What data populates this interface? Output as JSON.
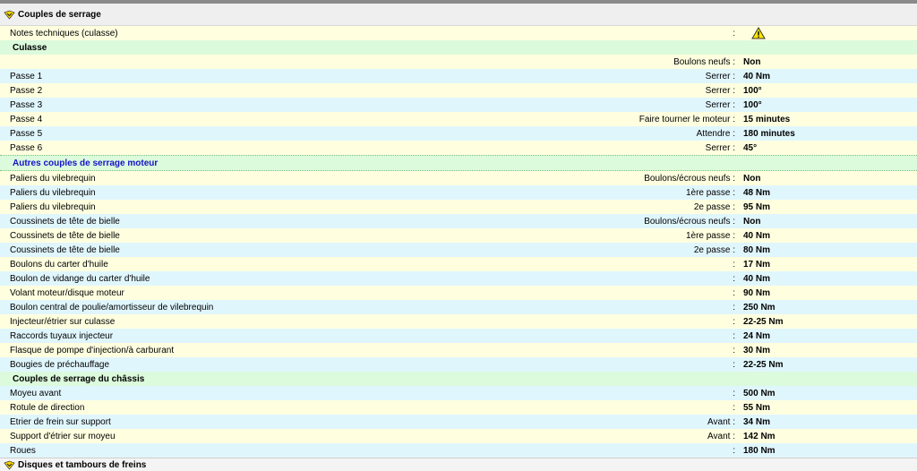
{
  "header": {
    "title": "Couples de serrage",
    "icon": "chevron-badge-icon"
  },
  "notes": {
    "label": "Notes techniques (culasse)",
    "sep": ":",
    "icon": "warning-icon"
  },
  "culasse": {
    "title": "Culasse",
    "rows": [
      {
        "label": "",
        "mid": "Boulons neufs :",
        "value": "Non"
      },
      {
        "label": "Passe 1",
        "mid": "Serrer :",
        "value": "40 Nm"
      },
      {
        "label": "Passe 2",
        "mid": "Serrer :",
        "value": "100°"
      },
      {
        "label": "Passe 3",
        "mid": "Serrer :",
        "value": "100°"
      },
      {
        "label": "Passe 4",
        "mid": "Faire tourner le moteur :",
        "value": "15 minutes"
      },
      {
        "label": "Passe 5",
        "mid": "Attendre :",
        "value": "180 minutes"
      },
      {
        "label": "Passe 6",
        "mid": "Serrer :",
        "value": "45°"
      }
    ]
  },
  "moteur": {
    "title": "Autres couples de serrage moteur",
    "rows": [
      {
        "label": "Paliers du vilebrequin",
        "mid": "Boulons/écrous neufs :",
        "value": "Non"
      },
      {
        "label": "Paliers du vilebrequin",
        "mid": "1ère passe :",
        "value": "48 Nm"
      },
      {
        "label": "Paliers du vilebrequin",
        "mid": "2e passe :",
        "value": "95 Nm"
      },
      {
        "label": "Coussinets de tête de bielle",
        "mid": "Boulons/écrous neufs :",
        "value": "Non"
      },
      {
        "label": "Coussinets de tête de bielle",
        "mid": "1ère passe :",
        "value": "40 Nm"
      },
      {
        "label": "Coussinets de tête de bielle",
        "mid": "2e passe :",
        "value": "80 Nm"
      },
      {
        "label": "Boulons du carter d'huile",
        "mid": ":",
        "value": "17 Nm"
      },
      {
        "label": "Boulon de vidange du carter d'huile",
        "mid": ":",
        "value": "40 Nm"
      },
      {
        "label": "Volant moteur/disque moteur",
        "mid": ":",
        "value": "90 Nm"
      },
      {
        "label": "Boulon central de poulie/amortisseur de vilebrequin",
        "mid": ":",
        "value": "250 Nm"
      },
      {
        "label": "Injecteur/étrier sur culasse",
        "mid": ":",
        "value": "22-25 Nm"
      },
      {
        "label": "Raccords tuyaux injecteur",
        "mid": ":",
        "value": "24 Nm"
      },
      {
        "label": "Flasque de pompe d'injection/à carburant",
        "mid": ":",
        "value": "30 Nm"
      },
      {
        "label": "Bougies de préchauffage",
        "mid": ":",
        "value": "22-25 Nm"
      }
    ]
  },
  "chassis": {
    "title": "Couples de serrage du châssis",
    "rows": [
      {
        "label": "Moyeu avant",
        "mid": ":",
        "value": "500 Nm"
      },
      {
        "label": "Rotule de direction",
        "mid": ":",
        "value": "55 Nm"
      },
      {
        "label": "Etrier de frein sur support",
        "mid": "Avant :",
        "value": "34 Nm"
      },
      {
        "label": "Support d'étrier sur moyeu",
        "mid": "Avant :",
        "value": "142 Nm"
      },
      {
        "label": "Roues",
        "mid": ":",
        "value": "180 Nm"
      }
    ]
  },
  "footer": {
    "title": "Disques et tambours de freins",
    "icon": "chevron-badge-icon"
  }
}
